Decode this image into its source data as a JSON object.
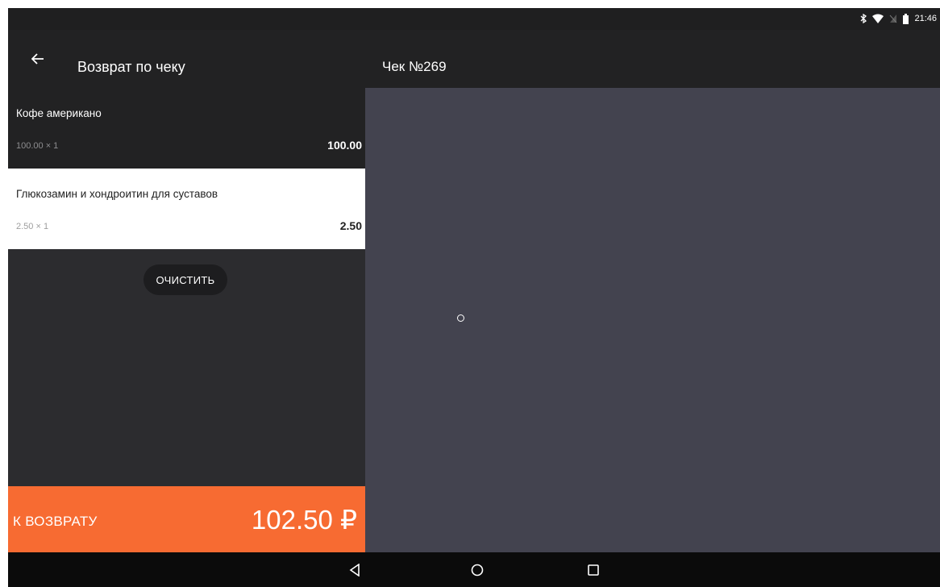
{
  "status_bar": {
    "time": "21:46",
    "icons": [
      "bluetooth-icon",
      "wifi-icon",
      "no-sim-icon",
      "battery-icon"
    ]
  },
  "app_bar": {
    "back_icon": "arrow-left-icon",
    "title": "Возврат по чеку",
    "receipt_title": "Чек №269"
  },
  "items": [
    {
      "name": "Кофе американо",
      "qty_line": "100.00 × 1",
      "sum": "100.00"
    },
    {
      "name": "Глюкозамин и хондроитин для суставов",
      "qty_line": "2.50 × 1",
      "sum": "2.50"
    }
  ],
  "clear_button": "ОЧИСТИТЬ",
  "total": {
    "label": "К ВОЗВРАТУ",
    "value": "102.50 ₽"
  },
  "colors": {
    "accent": "#f76b32",
    "appbar": "#222223",
    "left_bg": "#2c2c2f",
    "right_bg": "#43434f",
    "navbar": "#0b0b0b"
  },
  "nav_bar": {
    "icons": [
      "back-triangle-icon",
      "home-circle-icon",
      "recents-square-icon"
    ]
  }
}
